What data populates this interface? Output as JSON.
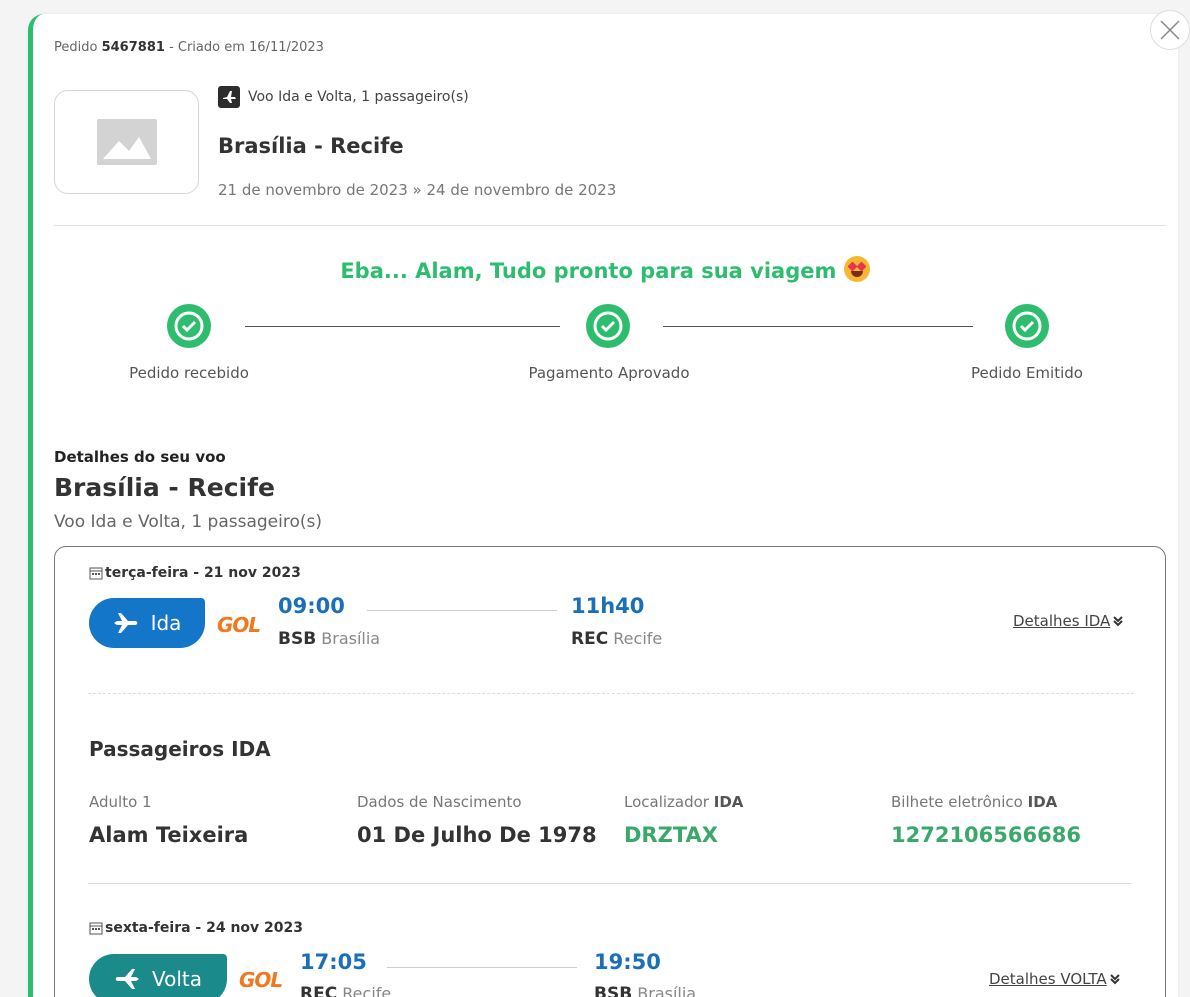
{
  "order": {
    "prefix": "Pedido",
    "number": "5467881",
    "created": "- Criado em 16/11/2023"
  },
  "summary": {
    "trip_type": "Voo Ida e Volta, 1 passageiro(s)",
    "route": "Brasília - Recife",
    "dates": "21 de novembro de 2023  »  24 de novembro de 2023"
  },
  "status": {
    "message": "Eba... Alam, Tudo pronto para sua viagem",
    "steps": [
      {
        "label": "Pedido recebido"
      },
      {
        "label": "Pagamento Aprovado"
      },
      {
        "label": "Pedido Emitido"
      }
    ]
  },
  "details": {
    "label": "Detalhes do seu voo",
    "route": "Brasília - Recife",
    "subtitle": "Voo Ida e Volta, 1 passageiro(s)"
  },
  "outbound": {
    "day": "terça-feira - 21 nov 2023",
    "pill": "Ida",
    "airline": "GOL",
    "dep_time": "09:00",
    "dep_code": "BSB",
    "dep_city": "Brasília",
    "arr_time": "11h40",
    "arr_code": "REC",
    "arr_city": "Recife",
    "details_link": "Detalhes IDA"
  },
  "passengers": {
    "title": "Passageiros IDA",
    "col1_label": "Adulto 1",
    "col1_value": "Alam Teixeira",
    "col2_label": "Dados de Nascimento",
    "col2_value": "01 De Julho De 1978",
    "col3_label_prefix": "Localizador",
    "col3_label_bold": "IDA",
    "col3_value": "DRZTAX",
    "col4_label_prefix": "Bilhete eletrônico",
    "col4_label_bold": "IDA",
    "col4_value": "1272106566686"
  },
  "return": {
    "day": "sexta-feira - 24 nov 2023",
    "pill": "Volta",
    "airline": "GOL",
    "dep_time": "17:05",
    "dep_code": "REC",
    "dep_city": "Recife",
    "arr_time": "19:50",
    "arr_code": "BSB",
    "arr_city": "Brasília",
    "details_link": "Detalhes VOLTA"
  },
  "colors": {
    "accent_green": "#2ebd6f",
    "ida_blue": "#1476c8",
    "volta_teal": "#1b8a8a",
    "gol_orange": "#f0781e"
  },
  "icons": [
    "close-icon",
    "image-placeholder-icon",
    "airplane-icon",
    "check-circle-icon",
    "calendar-icon",
    "chevron-double-down-icon",
    "star-eyes-emoji"
  ]
}
